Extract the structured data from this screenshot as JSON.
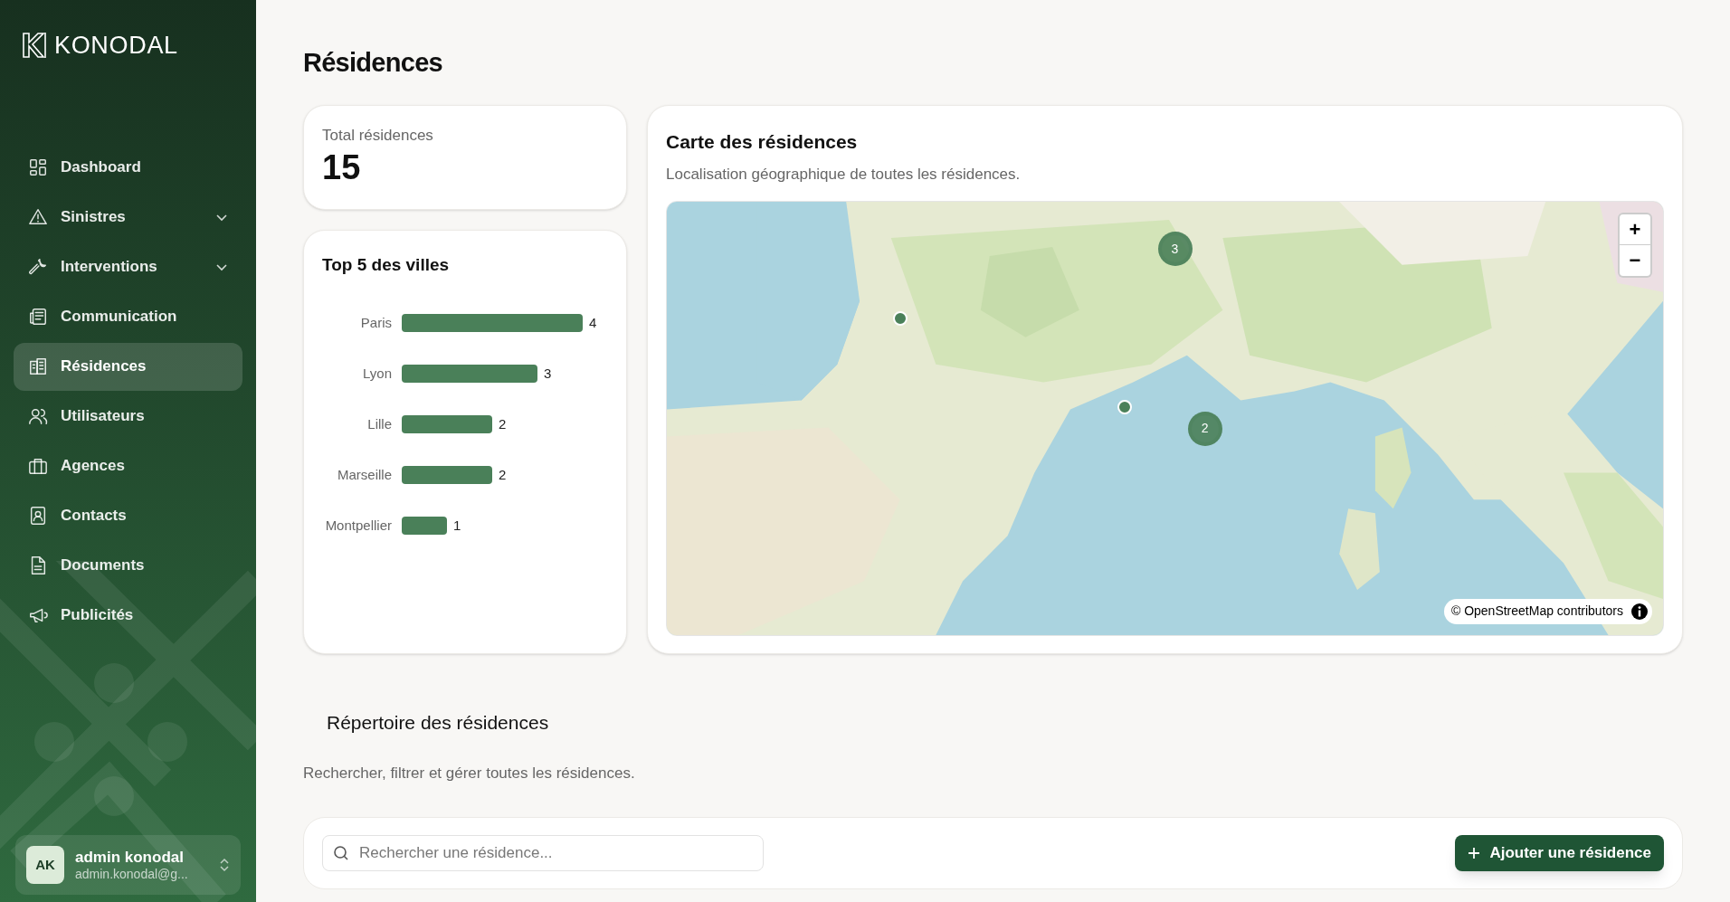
{
  "brand": {
    "name": "KONODAL"
  },
  "sidebar": {
    "items": [
      {
        "label": "Dashboard",
        "selected": false,
        "expandable": false
      },
      {
        "label": "Sinistres",
        "selected": false,
        "expandable": true
      },
      {
        "label": "Interventions",
        "selected": false,
        "expandable": true
      },
      {
        "label": "Communication",
        "selected": false,
        "expandable": false
      },
      {
        "label": "Résidences",
        "selected": true,
        "expandable": false
      },
      {
        "label": "Utilisateurs",
        "selected": false,
        "expandable": false
      },
      {
        "label": "Agences",
        "selected": false,
        "expandable": false
      },
      {
        "label": "Contacts",
        "selected": false,
        "expandable": false
      },
      {
        "label": "Documents",
        "selected": false,
        "expandable": false
      },
      {
        "label": "Publicités",
        "selected": false,
        "expandable": false
      }
    ],
    "user": {
      "initials": "AK",
      "name": "admin konodal",
      "email": "admin.konodal@g..."
    }
  },
  "page": {
    "title": "Résidences"
  },
  "total": {
    "label": "Total résidences",
    "value": "15"
  },
  "top_cities": {
    "title": "Top 5 des villes",
    "chart_data": {
      "type": "bar",
      "orientation": "horizontal",
      "categories": [
        "Paris",
        "Lyon",
        "Lille",
        "Marseille",
        "Montpellier"
      ],
      "values": [
        4,
        3,
        2,
        2,
        1
      ],
      "data_labels": true
    }
  },
  "map": {
    "title": "Carte des résidences",
    "subtitle": "Localisation géographique de toutes les résidences.",
    "zoom_in": "+",
    "zoom_out": "−",
    "attribution": "© OpenStreetMap contributors",
    "markers": [
      {
        "kind": "cluster",
        "count": "3"
      },
      {
        "kind": "point"
      },
      {
        "kind": "point"
      },
      {
        "kind": "cluster",
        "count": "2"
      }
    ]
  },
  "directory": {
    "title": "Répertoire des résidences",
    "subtitle": "Rechercher, filtrer et gérer toutes les résidences.",
    "search_placeholder": "Rechercher une résidence...",
    "add_button": "Ajouter une résidence"
  }
}
